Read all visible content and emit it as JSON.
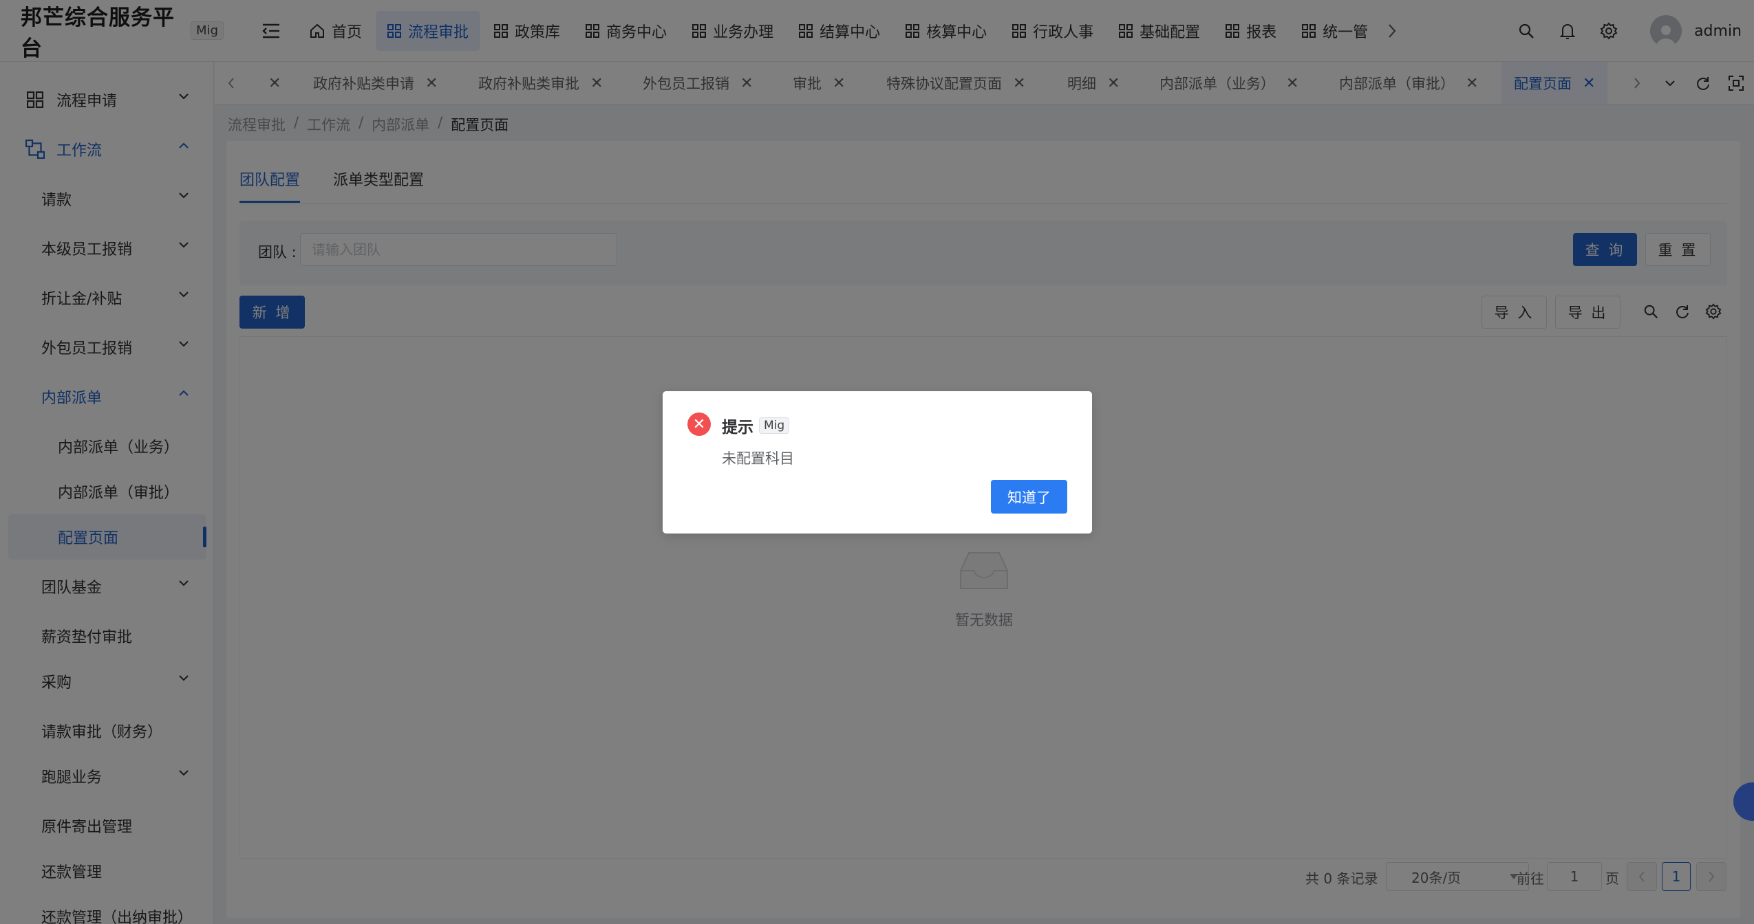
{
  "app": {
    "title": "邦芒综合服务平台",
    "env_badge": "Mig",
    "username": "admin"
  },
  "topnav": [
    {
      "label": "首页",
      "icon": "home-icon"
    },
    {
      "label": "流程审批",
      "icon": "grid-icon",
      "active": true
    },
    {
      "label": "政策库",
      "icon": "grid-icon"
    },
    {
      "label": "商务中心",
      "icon": "grid-icon"
    },
    {
      "label": "业务办理",
      "icon": "grid-icon"
    },
    {
      "label": "结算中心",
      "icon": "grid-icon"
    },
    {
      "label": "核算中心",
      "icon": "grid-icon"
    },
    {
      "label": "行政人事",
      "icon": "grid-icon"
    },
    {
      "label": "基础配置",
      "icon": "grid-icon"
    },
    {
      "label": "报表",
      "icon": "grid-icon"
    },
    {
      "label": "统一管",
      "icon": "grid-icon"
    }
  ],
  "sidebar": {
    "items": [
      {
        "label": "流程申请"
      },
      {
        "label": "工作流"
      },
      {
        "label": "请款"
      },
      {
        "label": "本级员工报销"
      },
      {
        "label": "折让金/补贴"
      },
      {
        "label": "外包员工报销"
      },
      {
        "label": "内部派单"
      },
      {
        "label": "内部派单（业务）"
      },
      {
        "label": "内部派单（审批）"
      },
      {
        "label": "配置页面"
      },
      {
        "label": "团队基金"
      },
      {
        "label": "薪资垫付审批"
      },
      {
        "label": "采购"
      },
      {
        "label": "请款审批（财务）"
      },
      {
        "label": "跑腿业务"
      },
      {
        "label": "原件寄出管理"
      },
      {
        "label": "还款管理"
      },
      {
        "label": "还款管理（出纳审批）"
      }
    ]
  },
  "tabs": [
    {
      "label": "政府补贴类申请"
    },
    {
      "label": "政府补贴类审批"
    },
    {
      "label": "外包员工报销"
    },
    {
      "label": "审批"
    },
    {
      "label": "特殊协议配置页面"
    },
    {
      "label": "明细"
    },
    {
      "label": "内部派单（业务）"
    },
    {
      "label": "内部派单（审批）"
    },
    {
      "label": "配置页面",
      "active": true
    }
  ],
  "breadcrumb": {
    "items": [
      "流程审批",
      "工作流",
      "内部派单"
    ],
    "current": "配置页面",
    "sep": "/"
  },
  "subtabs": [
    {
      "label": "团队配置",
      "active": true
    },
    {
      "label": "派单类型配置"
    }
  ],
  "filter": {
    "label": "团队 :",
    "placeholder": "请输入团队",
    "value": "",
    "query_label": "查 询",
    "reset_label": "重 置"
  },
  "toolbar": {
    "add_label": "新 增",
    "import_label": "导 入",
    "export_label": "导 出"
  },
  "table": {
    "empty_text": "暂无数据"
  },
  "pagination": {
    "total_text": "共 0 条记录",
    "page_size": "20条/页",
    "goto_prefix": "前往",
    "goto_value": "1",
    "goto_suffix": "页",
    "current_page": "1"
  },
  "dialog": {
    "title": "提示",
    "badge": "Mig",
    "message": "未配置科目",
    "ok_label": "知道了"
  },
  "colors": {
    "primary": "#2563c9",
    "error": "#f25050",
    "dialog_button": "#2b7cf3"
  }
}
